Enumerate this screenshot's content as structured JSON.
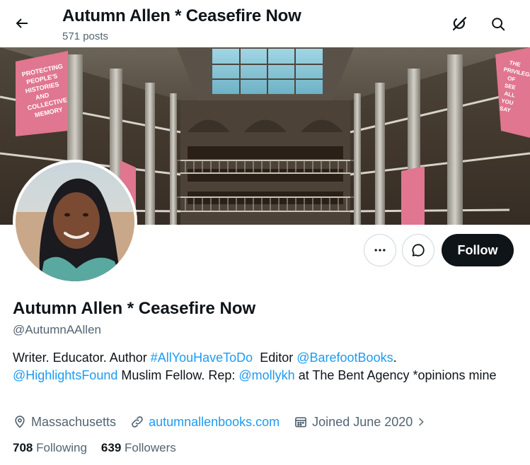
{
  "header": {
    "title": "Autumn Allen * Ceasefire Now",
    "posts_count": "571 posts"
  },
  "banner": {
    "banner_left_text": [
      "PROTECTING",
      "PEOPLE'S",
      "HISTORIES",
      "AND",
      "COLLECTIVE",
      "MEMORY"
    ],
    "banner_right_text": [
      "THE",
      "PRIVILEGE",
      "OF",
      "SEE",
      "ALL",
      "YOU",
      "SAY"
    ]
  },
  "actions": {
    "follow_label": "Follow"
  },
  "profile": {
    "name": "Autumn Allen * Ceasefire Now",
    "handle": "@AutumnAAllen",
    "bio": {
      "t1": "Writer. Educator. Author ",
      "hashtag": "#AllYouHaveToDo",
      "t2": "  Editor ",
      "mention1": "@BarefootBooks",
      "t3": ".",
      "mention2": "@HighlightsFound",
      "t4": " Muslim Fellow. Rep: ",
      "mention3": "@mollykh",
      "t5": " at The Bent Agency *opinions mine"
    },
    "location": "Massachusetts",
    "website": "autumnallenbooks.com",
    "joined": "Joined June 2020",
    "following_count": "708",
    "following_label": "Following",
    "followers_count": "639",
    "followers_label": "Followers"
  },
  "colors": {
    "accent": "#1d9bf0",
    "text_primary": "#0f1419",
    "text_secondary": "#536471",
    "follow_bg": "#0f1419"
  },
  "icons": [
    "back-arrow-icon",
    "grok-icon",
    "search-icon",
    "more-icon",
    "message-icon",
    "location-icon",
    "link-icon",
    "calendar-icon",
    "chevron-right-icon"
  ]
}
